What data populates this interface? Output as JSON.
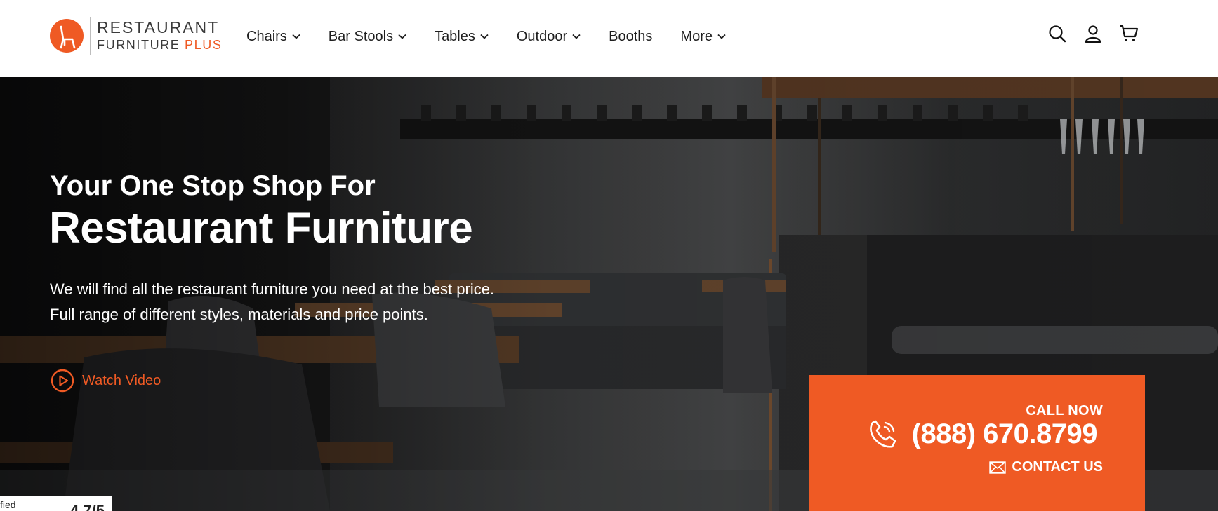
{
  "header": {
    "logo": {
      "line1": "RESTAURANT",
      "line2": "FURNITURE",
      "line2_accent": "PLUS"
    },
    "nav": [
      {
        "label": "Chairs",
        "dropdown": true
      },
      {
        "label": "Bar Stools",
        "dropdown": true
      },
      {
        "label": "Tables",
        "dropdown": true
      },
      {
        "label": "Outdoor",
        "dropdown": true
      },
      {
        "label": "Booths",
        "dropdown": false
      },
      {
        "label": "More",
        "dropdown": true
      }
    ],
    "icons": [
      "search-icon",
      "account-icon",
      "cart-icon"
    ]
  },
  "hero": {
    "subtitle": "Your One Stop Shop For",
    "title": "Restaurant Furniture",
    "description_line1": "We will find all the restaurant furniture you need at the best price.",
    "description_line2": "Full range of different styles, materials and price points.",
    "watch_video": "Watch Video",
    "cta": {
      "call_now": "CALL NOW",
      "phone": "(888) 670.8799",
      "contact": "CONTACT US"
    }
  },
  "badge": {
    "text": "fied",
    "rating": "4.7/5"
  },
  "colors": {
    "accent": "#ef5a24",
    "header_bg": "#ffffff",
    "text_dark": "#1e1e1e"
  }
}
